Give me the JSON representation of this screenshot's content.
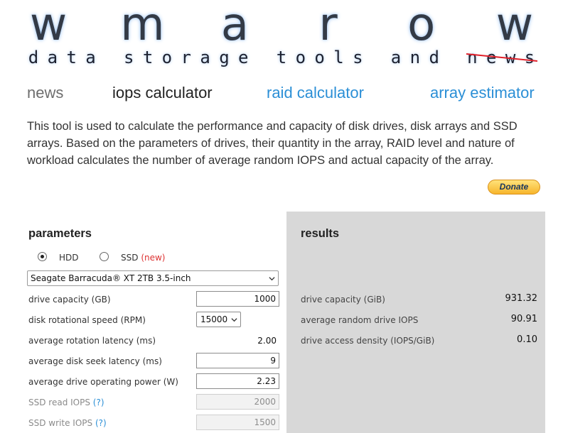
{
  "logo": {
    "big_letters": [
      "w",
      "m",
      "a",
      "r",
      "o",
      "w"
    ],
    "tagline_letters": [
      "d",
      "a",
      "t",
      "a",
      " ",
      "s",
      "t",
      "o",
      "r",
      "a",
      "g",
      "e",
      " ",
      "t",
      "o",
      "o",
      "l",
      "s",
      " ",
      "a",
      "n",
      "d",
      " ",
      "n",
      "e",
      "w",
      "s"
    ]
  },
  "nav": {
    "news": "news",
    "iops": "iops calculator",
    "raid": "raid calculator",
    "array": "array estimator"
  },
  "intro": "This tool is used to calculate the performance and capacity of disk drives, disk arrays and SSD arrays. Based on the parameters of drives, their quantity in the array, RAID level and nature of workload calculates the number of average random IOPS and actual capacity of the array.",
  "donate_label": "Donate",
  "parameters": {
    "heading": "parameters",
    "drive_type": {
      "hdd_label": "HDD",
      "ssd_label": "SSD",
      "ssd_badge": "(new)",
      "selected": "HDD"
    },
    "drive_model": "Seagate Barracuda® XT 2TB 3.5-inch",
    "drive_capacity": {
      "label": "drive capacity (GB)",
      "value": "1000"
    },
    "rotational_speed": {
      "label": "disk rotational speed (RPM)",
      "value": "15000"
    },
    "rotation_latency": {
      "label": "average rotation latency (ms)",
      "value": "2.00"
    },
    "seek_latency": {
      "label": "average disk seek latency (ms)",
      "value": "9"
    },
    "operating_power": {
      "label": "average drive operating power (W)",
      "value": "2.23"
    },
    "ssd_read": {
      "label": "SSD read IOPS",
      "help": "(?)",
      "value": "2000"
    },
    "ssd_write": {
      "label": "SSD write IOPS",
      "help": "(?)",
      "value": "1500"
    }
  },
  "results": {
    "heading": "results",
    "drive_capacity": {
      "label": "drive capacity (GiB)",
      "value": "931.32"
    },
    "random_iops": {
      "label": "average random drive IOPS",
      "value": "90.91"
    },
    "access_density": {
      "label": "drive access density (IOPS/GiB)",
      "value": "0.10"
    }
  },
  "colors": {
    "nav_link": "#2b8fd6",
    "nav_inactive": "#6e6e6e",
    "results_bg": "#d8d8d8",
    "badge_red": "#dd3333",
    "strike_red": "#e0202a"
  }
}
